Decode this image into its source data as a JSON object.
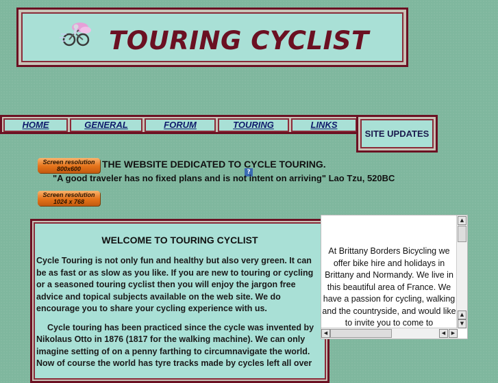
{
  "header": {
    "title": "TOURING CYCLIST"
  },
  "nav": {
    "items": [
      "HOME",
      "GENERAL",
      "FORUM",
      "TOURING",
      "LINKS"
    ],
    "site_updates": "SITE UPDATES"
  },
  "badges": {
    "res1": {
      "line1": "Screen resolution",
      "line2": "800x600"
    },
    "res2": {
      "line1": "Screen resolution",
      "line2": "1024 x 768"
    }
  },
  "intro": {
    "tagline": "THE WEBSITE DEDICATED TO CYCLE TOURING.",
    "quote": "\"A good traveler has no fixed plans and is not intent on arriving\" Lao Tzu, 520BC",
    "help_icon": "?"
  },
  "welcome": {
    "title": "WELCOME TO TOURING CYCLIST",
    "para1": "Cycle Touring is not only fun and healthy but also very green. It can be as fast or as slow as you like. If you are new to touring or cycling or a seasoned touring cyclist then you will enjoy the jargon free advice and topical subjects available on the web site. We do encourage you to share your cycling experience with us.",
    "para2": "Cycle touring has been practiced since the cycle was invented by Nikolaus Otto in 1876 (1817 for the walking machine). We can only imagine setting of on a penny farthing to circumnavigate the world. Now of course the world has tyre tracks made by cycles left all over"
  },
  "ad": {
    "text": "At Brittany Borders Bicycling we offer bike hire and holidays in Brittany and Normandy. We live in this beautiful area of France. We have a passion for cycling, walking and the countryside, and would like to invite you to come to"
  },
  "colors": {
    "border": "#6b1022",
    "panel": "#a9e0d6",
    "title": "#6b1022",
    "link": "#0e1a6b",
    "background": "#7fb79e"
  }
}
